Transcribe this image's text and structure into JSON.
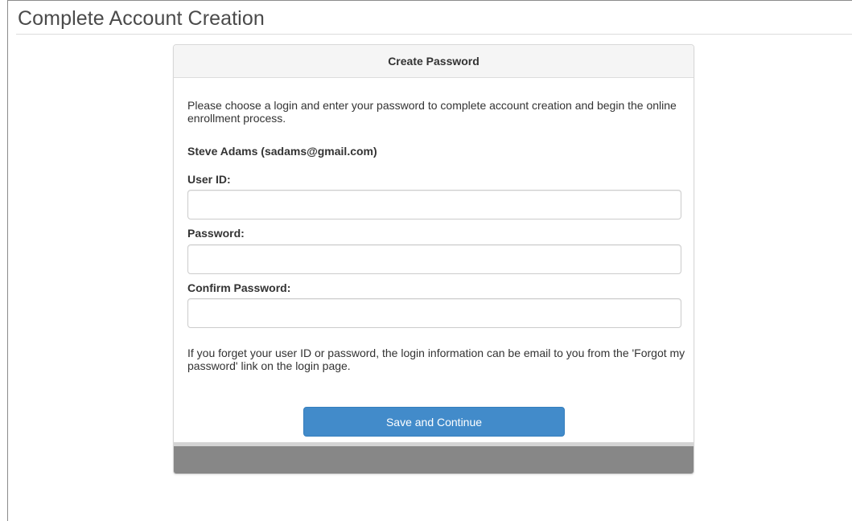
{
  "page": {
    "title": "Complete Account Creation"
  },
  "panel": {
    "heading": "Create Password",
    "intro": "Please choose a login and enter your password to complete account creation and begin the online enrollment process.",
    "user_display": "Steve Adams (sadams@gmail.com)",
    "fields": {
      "user_id": {
        "label": "User ID:",
        "value": "",
        "placeholder": ""
      },
      "password": {
        "label": "Password:",
        "value": "",
        "placeholder": ""
      },
      "confirm_password": {
        "label": "Confirm Password:",
        "value": "",
        "placeholder": ""
      }
    },
    "help_text": "If you forget your user ID or password, the login information can be email to you from the 'Forgot my password' link on the login page.",
    "save_label": "Save and Continue"
  },
  "colors": {
    "primary_button": "#428bca",
    "panel_heading_bg": "#f5f5f5",
    "footer_bg": "#878787"
  }
}
